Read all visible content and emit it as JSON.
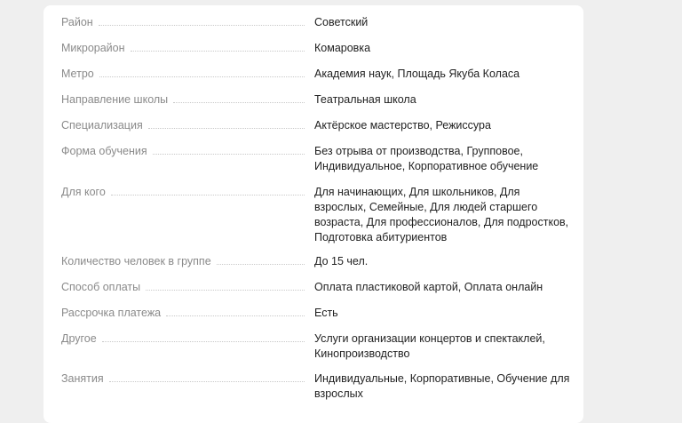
{
  "rows": [
    {
      "label": "Район",
      "value": "Советский"
    },
    {
      "label": "Микрорайон",
      "value": "Комаровка"
    },
    {
      "label": "Метро",
      "value": "Академия наук, Площадь Якуба Коласа"
    },
    {
      "label": "Направление школы",
      "value": "Театральная школа"
    },
    {
      "label": "Специализация",
      "value": "Актёрское мастерство, Режиссура"
    },
    {
      "label": "Форма обучения",
      "value": "Без отрыва от производства, Групповое, Индивидуальное, Корпоративное обучение"
    },
    {
      "label": "Для кого",
      "value": "Для начинающих, Для школьников, Для взрослых, Семейные, Для людей старшего возраста, Для профессионалов, Для подростков, Подготовка абитуриентов"
    },
    {
      "label": "Количество человек в группе",
      "value": "До 15 чел."
    },
    {
      "label": "Способ оплаты",
      "value": "Оплата пластиковой картой, Оплата онлайн"
    },
    {
      "label": "Рассрочка платежа",
      "value": "Есть"
    },
    {
      "label": "Другое",
      "value": "Услуги организации концертов и спектаклей, Кинопроизводство"
    },
    {
      "label": "Занятия",
      "value": "Индивидуальные, Корпоративные, Обучение для взрослых"
    }
  ]
}
